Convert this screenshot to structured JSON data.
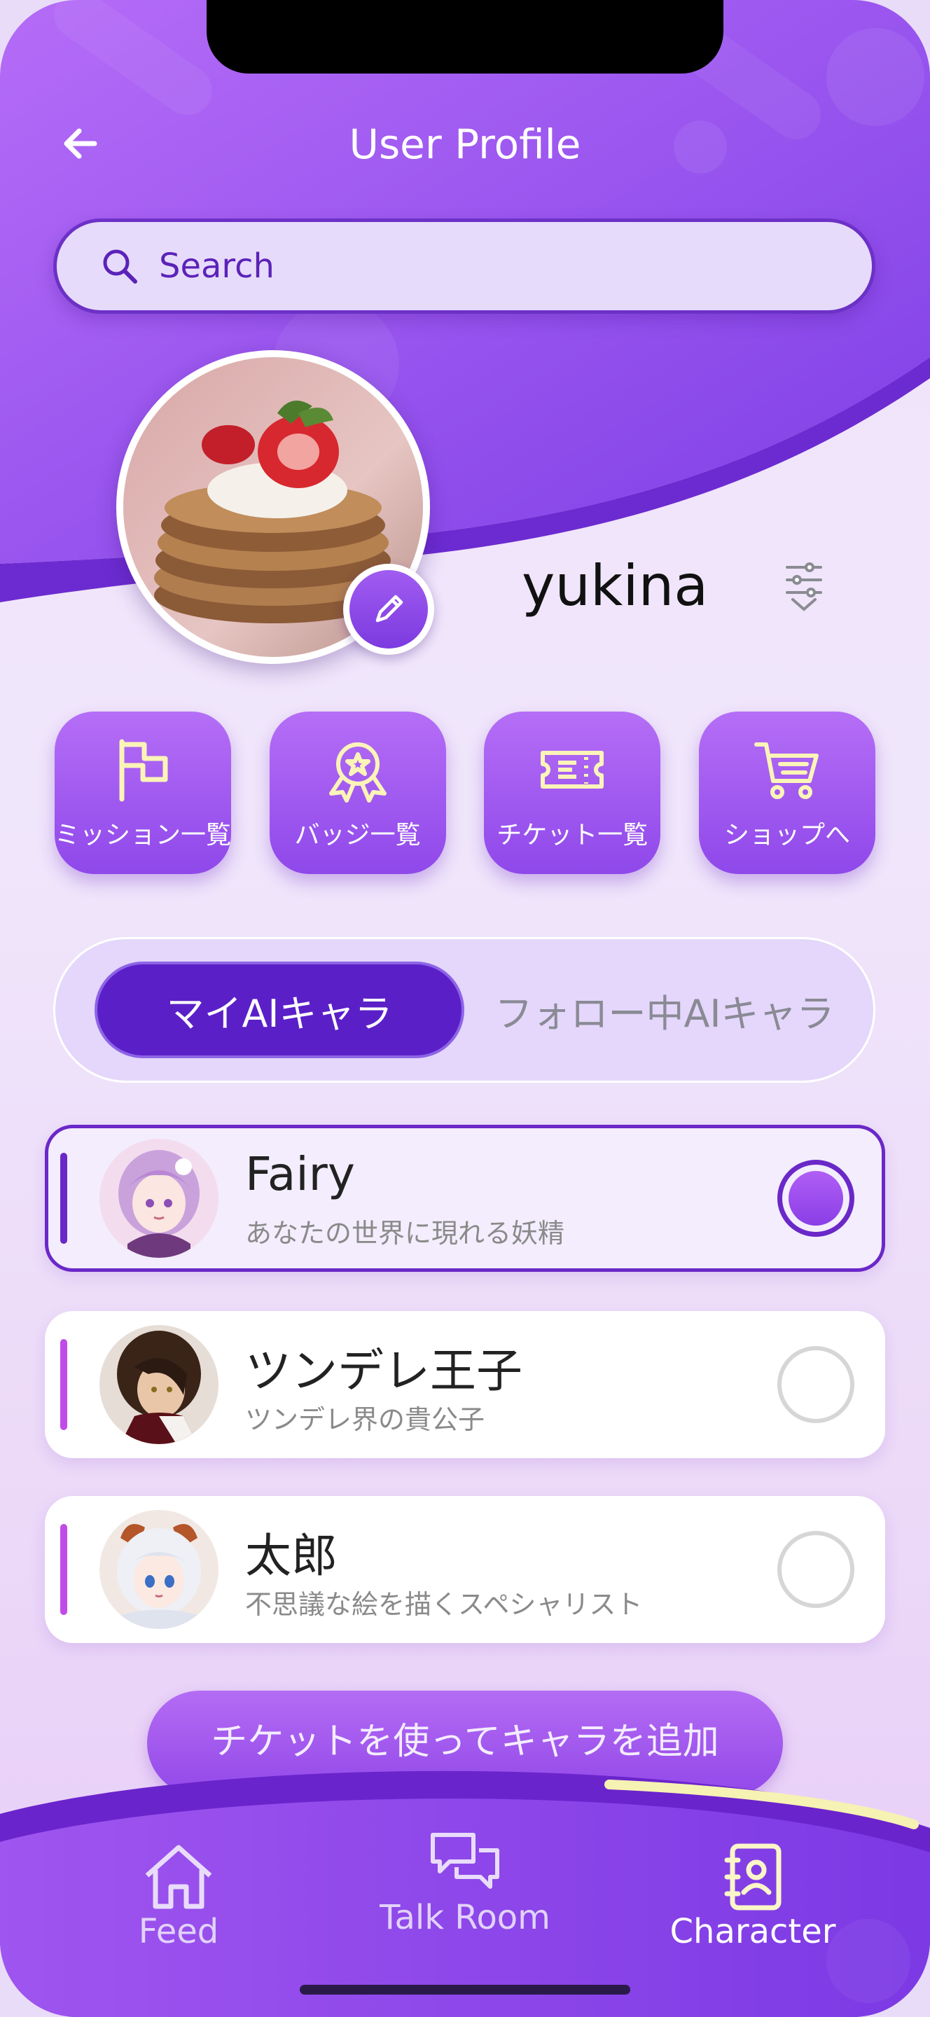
{
  "header": {
    "title": "User Profile",
    "back_icon": "arrow-left-icon"
  },
  "search": {
    "placeholder": "Search",
    "icon": "search-icon"
  },
  "profile": {
    "username": "yukina",
    "avatar": "pancake-stack-photo",
    "edit_icon": "pencil-icon",
    "filter_icon": "sliders-icon"
  },
  "actions": [
    {
      "label": "ミッション一覧",
      "icon": "flag-icon"
    },
    {
      "label": "バッジ一覧",
      "icon": "badge-icon"
    },
    {
      "label": "チケット一覧",
      "icon": "ticket-icon"
    },
    {
      "label": "ショップへ",
      "icon": "cart-icon"
    }
  ],
  "tabs": [
    {
      "label": "マイAIキャラ",
      "active": true
    },
    {
      "label": "フォロー中AIキャラ",
      "active": false
    }
  ],
  "characters": [
    {
      "name": "Fairy",
      "description": "あなたの世界に現れる妖精",
      "selected": true
    },
    {
      "name": "ツンデレ王子",
      "description": "ツンデレ界の貴公子",
      "selected": false
    },
    {
      "name": "太郎",
      "description": "不思議な絵を描くスペシャリスト",
      "selected": false
    }
  ],
  "add_button": {
    "label": "チケットを使ってキャラを追加"
  },
  "nav": [
    {
      "label": "Feed",
      "icon": "home-icon"
    },
    {
      "label": "Talk Room",
      "icon": "chat-bubbles-icon"
    },
    {
      "label": "Character",
      "icon": "contacts-book-icon",
      "active": true
    }
  ],
  "colors": {
    "primary": "#5b1fc8",
    "accent": "#9248e8",
    "background": "#efe3fb"
  }
}
